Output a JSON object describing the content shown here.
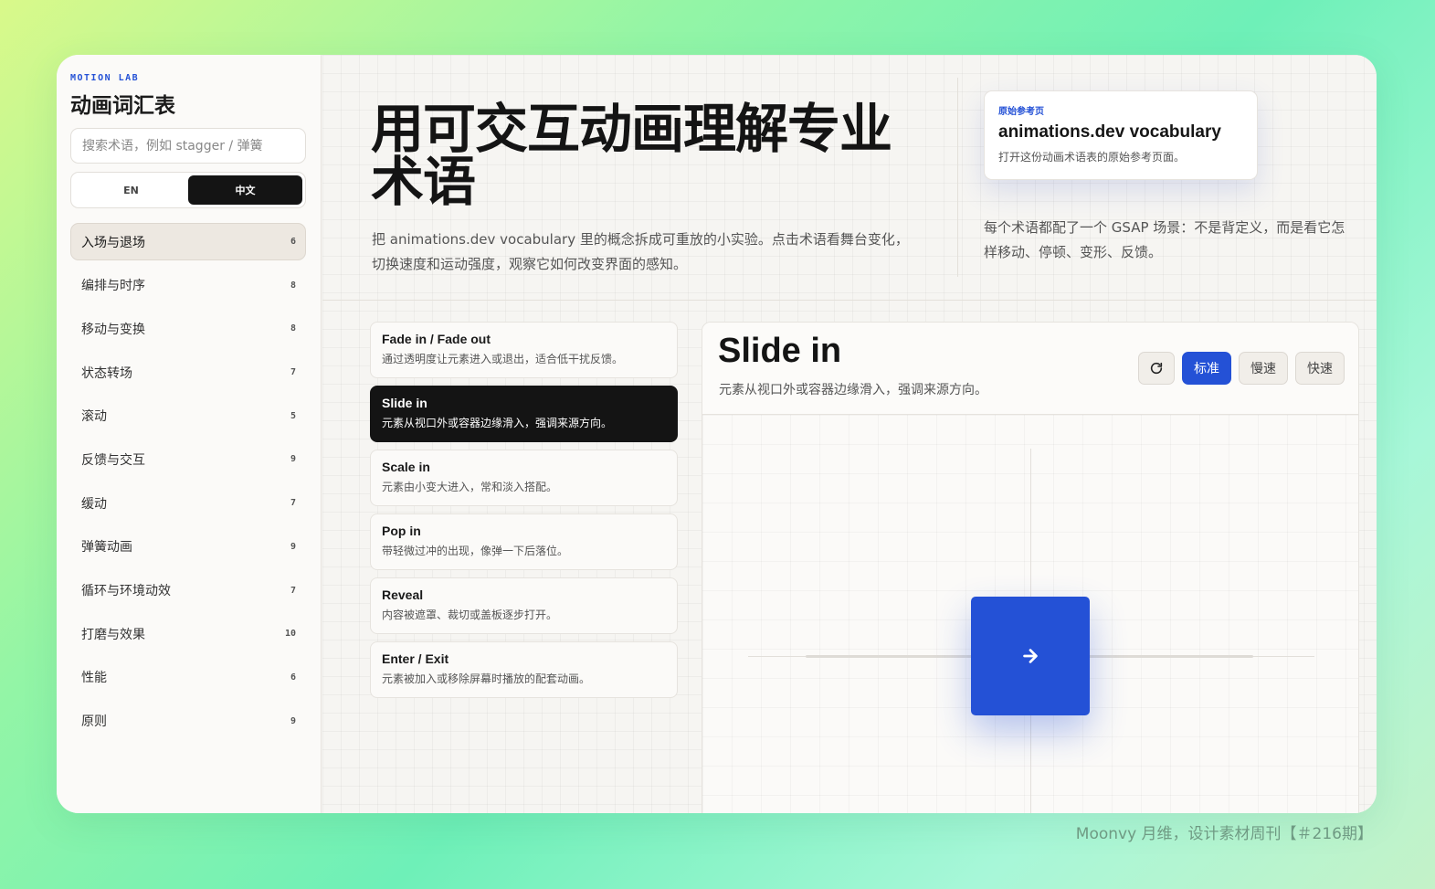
{
  "sidebar": {
    "kicker": "MOTION LAB",
    "title": "动画词汇表",
    "search_placeholder": "搜索术语，例如 stagger / 弹簧",
    "lang": {
      "en": "EN",
      "zh": "中文",
      "active": "zh"
    },
    "items": [
      {
        "label": "入场与退场",
        "count": "6",
        "active": true
      },
      {
        "label": "编排与时序",
        "count": "8"
      },
      {
        "label": "移动与变换",
        "count": "8"
      },
      {
        "label": "状态转场",
        "count": "7"
      },
      {
        "label": "滚动",
        "count": "5"
      },
      {
        "label": "反馈与交互",
        "count": "9"
      },
      {
        "label": "缓动",
        "count": "7"
      },
      {
        "label": "弹簧动画",
        "count": "9"
      },
      {
        "label": "循环与环境动效",
        "count": "7"
      },
      {
        "label": "打磨与效果",
        "count": "10"
      },
      {
        "label": "性能",
        "count": "6"
      },
      {
        "label": "原则",
        "count": "9"
      }
    ]
  },
  "hero": {
    "title": "用可交互动画理解专业术语",
    "description": "把 animations.dev vocabulary 里的概念拆成可重放的小实验。点击术语看舞台变化，切换速度和运动强度，观察它如何改变界面的感知。",
    "ref_card": {
      "kicker": "原始参考页",
      "title": "animations.dev vocabulary",
      "subtitle": "打开这份动画术语表的原始参考页面。"
    },
    "note": "每个术语都配了一个 GSAP 场景：不是背定义，而是看它怎样移动、停顿、变形、反馈。"
  },
  "terms": [
    {
      "name": "Fade in / Fade out",
      "desc": "通过透明度让元素进入或退出，适合低干扰反馈。"
    },
    {
      "name": "Slide in",
      "desc": "元素从视口外或容器边缘滑入，强调来源方向。",
      "active": true
    },
    {
      "name": "Scale in",
      "desc": "元素由小变大进入，常和淡入搭配。"
    },
    {
      "name": "Pop in",
      "desc": "带轻微过冲的出现，像弹一下后落位。"
    },
    {
      "name": "Reveal",
      "desc": "内容被遮罩、裁切或盖板逐步打开。"
    },
    {
      "name": "Enter / Exit",
      "desc": "元素被加入或移除屏幕时播放的配套动画。"
    }
  ],
  "stage": {
    "title": "Slide in",
    "subtitle": "元素从视口外或容器边缘滑入，强调来源方向。",
    "replay_icon": "replay-icon",
    "speeds": {
      "standard": "标准",
      "slow": "慢速",
      "fast": "快速",
      "active": "standard"
    },
    "demo_icon": "arrow-right-icon",
    "accent": "#2451d6"
  },
  "credit": "Moonvy 月维，设计素材周刊【＃216期】"
}
